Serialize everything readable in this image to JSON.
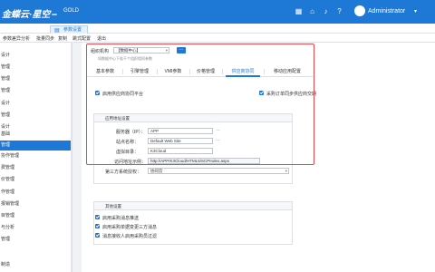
{
  "header": {
    "brand": "金蝶云·星空",
    "brand_badge": "",
    "edition": "GOLD",
    "user": "Administrator",
    "icons": [
      "apps-grid-icon",
      "home-icon",
      "bell-icon",
      "help-icon",
      "settings-icon",
      "user-avatar",
      "caret-down-icon"
    ]
  },
  "doc_tab": {
    "label": "参数设置"
  },
  "menubar": {
    "items": [
      "参数差异分析",
      "批量同步",
      "复制",
      "跳式配置",
      "退出"
    ]
  },
  "sidebar": {
    "items": [
      "",
      "设计",
      "管理",
      "管理",
      "管理",
      "设计",
      "管理",
      "",
      "设计",
      "基础",
      "管理",
      "",
      "协作管理",
      "",
      "费管理",
      "价管理",
      "作管理",
      "报销管理",
      "目管理",
      "与分析",
      "管理",
      "",
      "",
      "",
      "",
      "",
      "",
      "",
      "制造"
    ],
    "active_index": 10
  },
  "form": {
    "org_label": "组织机构",
    "org_value": "【数据中心】",
    "more_button": "...",
    "hint": "如数据中心下若干个组织相同参数",
    "tabs": [
      "基本参数",
      "引擎管理",
      "VMI参数",
      "价格管理",
      "供应商协同",
      "移动应用配置"
    ],
    "active_tab": 4,
    "checkbox_platform": "启用供应商协同平台",
    "checkbox_sync": "采购订单同步供应商交期",
    "app_section_title": "应用地址设置",
    "server_label": "服务器（IP）：",
    "server_value": "APP",
    "site_label": "站点名称：",
    "site_value": "Default Web Site",
    "vdir_label": "虚拟目录：",
    "vdir_value": "K3Cloud",
    "url_label": "访问地址示例：",
    "url_value": "http://APP/K3Cloud/HTML5/SCPIndex.aspx",
    "third_label": "第三方系统授权：",
    "third_value": "协同云",
    "other_section_title": "其他设置",
    "options": [
      "启用采购消息推送",
      "启用采购单据变更三方消息",
      "消息接收人启用采购员过滤"
    ]
  },
  "colors": {
    "accent": "#1d78d6",
    "highlight": "#e8464f"
  }
}
